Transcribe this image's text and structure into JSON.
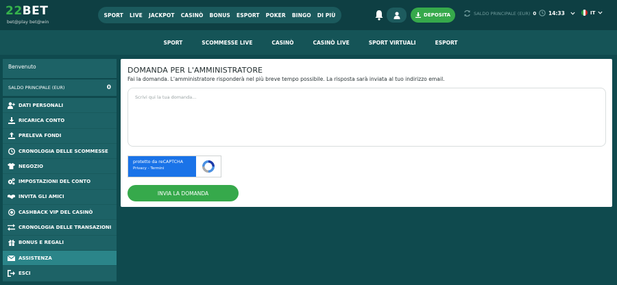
{
  "header": {
    "logo": {
      "prefix": "22",
      "name": "BET",
      "slogan": "bet@play bet@win"
    },
    "nav": [
      "SPORT",
      "LIVE",
      "JACKPOT",
      "CASINÒ",
      "BONUS",
      "ESPORT",
      "POKER",
      "BINGO",
      "DI PIÙ"
    ],
    "deposit_label": "DEPOSITA",
    "balance_label": "SALDO PRINCIPALE (EUR)",
    "balance_value": "0",
    "time": "14:33",
    "language": "IT"
  },
  "subnav": [
    "SPORT",
    "SCOMMESSE LIVE",
    "CASINÒ",
    "CASINÒ LIVE",
    "SPORT VIRTUALI",
    "ESPORT"
  ],
  "sidebar": {
    "welcome": "Benvenuto",
    "balance_label": "SALDO PRINCIPALE (EUR)",
    "balance_value": "0",
    "items": [
      {
        "label": "DATI PERSONALI",
        "icon": "user-plus-icon"
      },
      {
        "label": "RICARICA CONTO",
        "icon": "download-icon"
      },
      {
        "label": "PRELEVA FONDI",
        "icon": "upload-icon"
      },
      {
        "label": "CRONOLOGIA DELLE SCOMMESSE",
        "icon": "clock-icon"
      },
      {
        "label": "NEGOZIO",
        "icon": "shirt-icon"
      },
      {
        "label": "IMPOSTAZIONI DEL CONTO",
        "icon": "gears-icon"
      },
      {
        "label": "INVITA GLI AMICI",
        "icon": "handshake-icon"
      },
      {
        "label": "CASHBACK VIP DEL CASINÒ",
        "icon": "coin-icon"
      },
      {
        "label": "CRONOLOGIA DELLE TRANSAZIONI",
        "icon": "exchange-icon"
      },
      {
        "label": "BONUS E REGALI",
        "icon": "gift-icon"
      },
      {
        "label": "ASSISTENZA",
        "icon": "envelope-icon",
        "active": true
      },
      {
        "label": "ESCI",
        "icon": "logout-icon"
      }
    ]
  },
  "main": {
    "title": "DOMANDA PER L'AMMINISTRATORE",
    "subtitle": "Fai la domanda. L'amministratore risponderà nel più breve tempo possibile. La risposta sarà inviata al tuo indirizzo email.",
    "question_placeholder": "Scrivi qui la tua domanda...",
    "recaptcha": {
      "line1": "protetto da reCAPTCHA",
      "line2": "Privacy - Termini"
    },
    "submit_label": "INVIA LA DOMANDA"
  },
  "colors": {
    "accent": "#36a94b",
    "bg": "#0f4a4e",
    "panel": "#ffffff"
  }
}
